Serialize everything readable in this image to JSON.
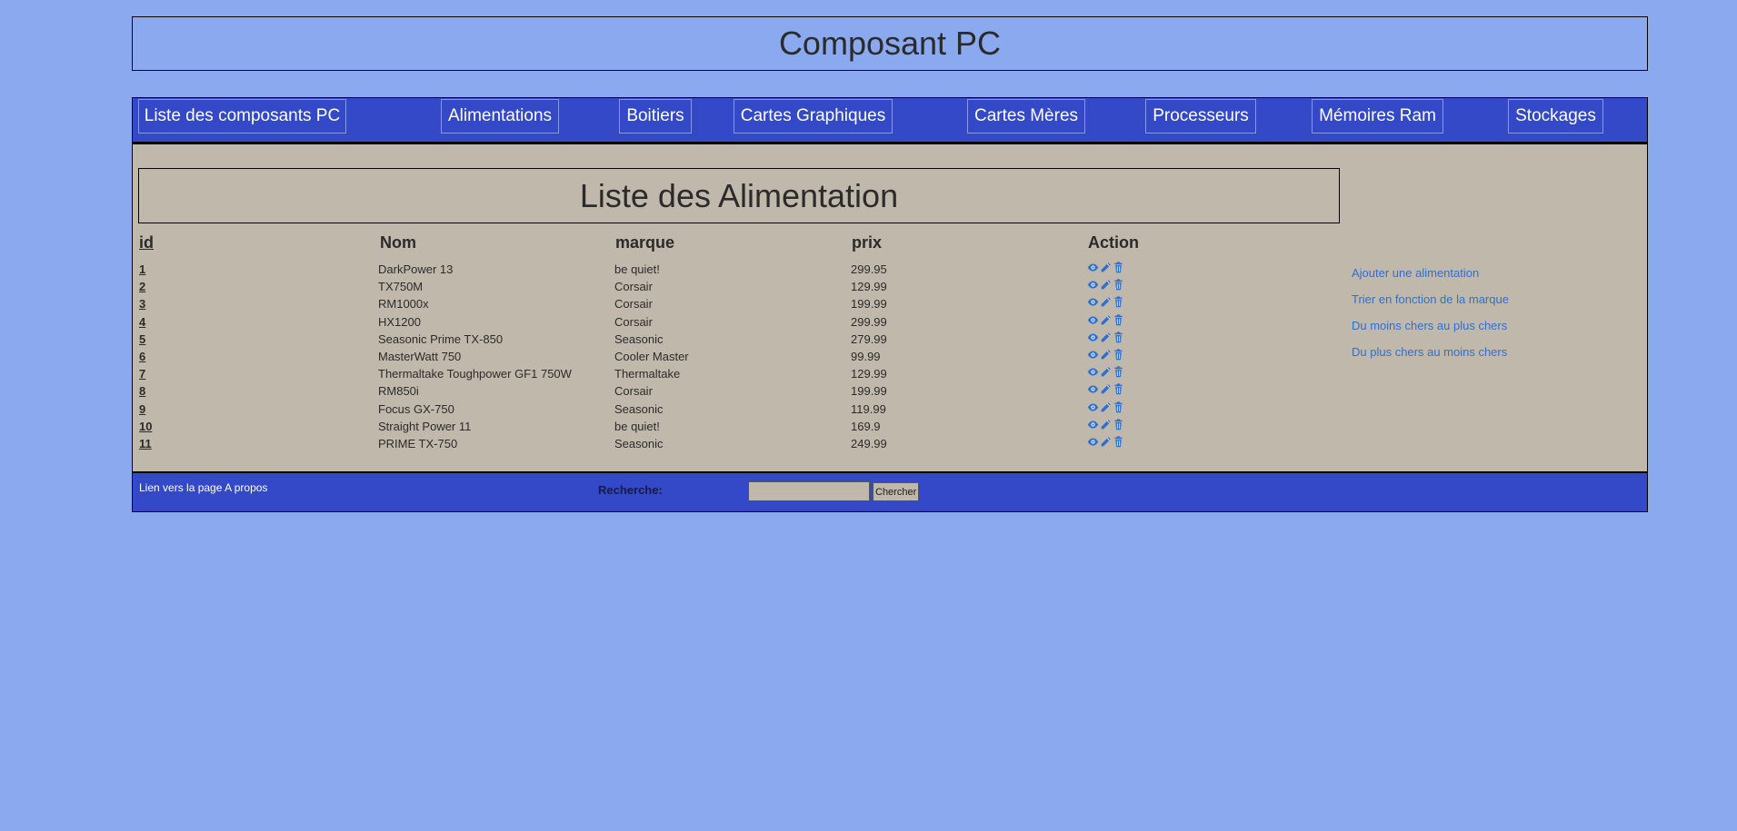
{
  "header": {
    "title": "Composant PC"
  },
  "nav": {
    "items": [
      {
        "label": "Liste des composants PC"
      },
      {
        "label": "Alimentations"
      },
      {
        "label": "Boitiers"
      },
      {
        "label": "Cartes Graphiques"
      },
      {
        "label": "Cartes Mères"
      },
      {
        "label": "Processeurs"
      },
      {
        "label": "Mémoires Ram"
      },
      {
        "label": "Stockages"
      }
    ]
  },
  "main": {
    "heading": "Liste des Alimentation",
    "table": {
      "columns": [
        "id",
        "Nom",
        "marque",
        "prix",
        "Action"
      ],
      "rows": [
        {
          "id": "1",
          "nom": "DarkPower 13",
          "marque": "be quiet!",
          "prix": "299.95"
        },
        {
          "id": "2",
          "nom": "TX750M",
          "marque": "Corsair",
          "prix": "129.99"
        },
        {
          "id": "3",
          "nom": "RM1000x",
          "marque": "Corsair",
          "prix": "199.99"
        },
        {
          "id": "4",
          "nom": "HX1200",
          "marque": "Corsair",
          "prix": "299.99"
        },
        {
          "id": "5",
          "nom": "Seasonic Prime TX-850",
          "marque": "Seasonic",
          "prix": "279.99"
        },
        {
          "id": "6",
          "nom": "MasterWatt 750",
          "marque": "Cooler Master",
          "prix": "99.99"
        },
        {
          "id": "7",
          "nom": "Thermaltake Toughpower GF1 750W",
          "marque": "Thermaltake",
          "prix": "129.99"
        },
        {
          "id": "8",
          "nom": "RM850i",
          "marque": "Corsair",
          "prix": "199.99"
        },
        {
          "id": "9",
          "nom": "Focus GX-750",
          "marque": "Seasonic",
          "prix": "119.99"
        },
        {
          "id": "10",
          "nom": "Straight Power 11",
          "marque": "be quiet!",
          "prix": "169.9"
        },
        {
          "id": "11",
          "nom": "PRIME TX-750",
          "marque": "Seasonic",
          "prix": "249.99"
        }
      ],
      "action_icons": [
        "eye-icon",
        "pencil-icon",
        "trash-icon"
      ]
    },
    "side_links": [
      {
        "label": "Ajouter une alimentation"
      },
      {
        "label": "Trier en fonction de la marque"
      },
      {
        "label": "Du moins chers au plus chers"
      },
      {
        "label": "Du plus chers au moins chers"
      }
    ]
  },
  "footer": {
    "about_link": "Lien vers la page A propos",
    "search_label": "Recherche:",
    "search_value": "",
    "search_button": "Chercher"
  },
  "colors": {
    "page_background": "#8aa9ef",
    "bar_background": "#3349c7",
    "content_background": "#c1b8ac",
    "link_color": "#2f6fd1",
    "icon_color": "#2f6fd1"
  }
}
